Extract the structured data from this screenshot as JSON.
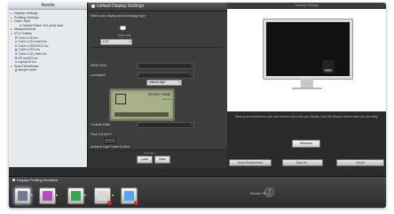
{
  "sidebar": {
    "title": "Assets",
    "items": [
      {
        "label": "Display Settings",
        "level": 1,
        "arrow": "▸"
      },
      {
        "label": "Profiling Settings",
        "level": 1,
        "arrow": "▸"
      },
      {
        "label": "Patch Sets",
        "level": 1,
        "arrow": "▾"
      },
      {
        "label": "Default Patch Set (mid).dset",
        "level": 3,
        "arrow": ""
      },
      {
        "label": "Measurements",
        "level": 1,
        "arrow": "▸"
      },
      {
        "label": "ICC Profiles",
        "level": 1,
        "arrow": "▾"
      },
      {
        "label": "Color LCD.icc",
        "level": 2,
        "arrow": ""
      },
      {
        "label": "Color LCD mac2.icc",
        "level": 2,
        "arrow": ""
      },
      {
        "label": "Color LCD011311.icc",
        "level": 2,
        "arrow": ""
      },
      {
        "label": "Color LCD2.icc",
        "level": 2,
        "arrow": ""
      },
      {
        "label": "Color LCD_test1.icc",
        "level": 2,
        "arrow": ""
      },
      {
        "label": "HP w2022.icc",
        "level": 2,
        "arrow": ""
      },
      {
        "label": "Laptop11.icc",
        "level": 2,
        "arrow": ""
      },
      {
        "label": "Spool Workflows",
        "level": 1,
        "arrow": "▾"
      },
      {
        "label": "sample.dwsf",
        "level": 2,
        "arrow": ""
      }
    ]
  },
  "settings": {
    "header": "Default Display Settings",
    "technology_label": "Select your display and technology type",
    "display_name": "Color LCD",
    "technology_value": "LCD",
    "white_point_label": "White Point",
    "white_point_value": "",
    "luminance_label": "Luminance",
    "luminance_value": "",
    "ambient_value": "ambient light",
    "lcd_status": "Device ready",
    "contrast_label": "Contrast Ratio",
    "flare_label": "Flare Correct™",
    "ambient_smart_label": "Ambient Light Smart Control",
    "footer_new": "New Item",
    "load_label": "Load",
    "save_label": "Save"
  },
  "preview": {
    "title": "Display Settings",
    "instructions": "Place your instrument on your work surface next to the your display. Click the Measure button when you are ready.",
    "measure_label": "Measure",
    "delete_label": "Keep Measurement",
    "save_as_label": "Save As...",
    "cancel_label": "Cancel"
  },
  "workflow": {
    "title": "Display Profiling Workflow",
    "preview_label": "Preview  Off",
    "step_colors": [
      "#6f7b8f",
      "#b04fb8",
      "#3aa650",
      "#d7d7d7",
      "#5aa4ee"
    ]
  },
  "colors": {
    "lcd_bg": "#a8b08a",
    "panel": "#3d3d3d",
    "workflow": "#3a3a3a"
  }
}
